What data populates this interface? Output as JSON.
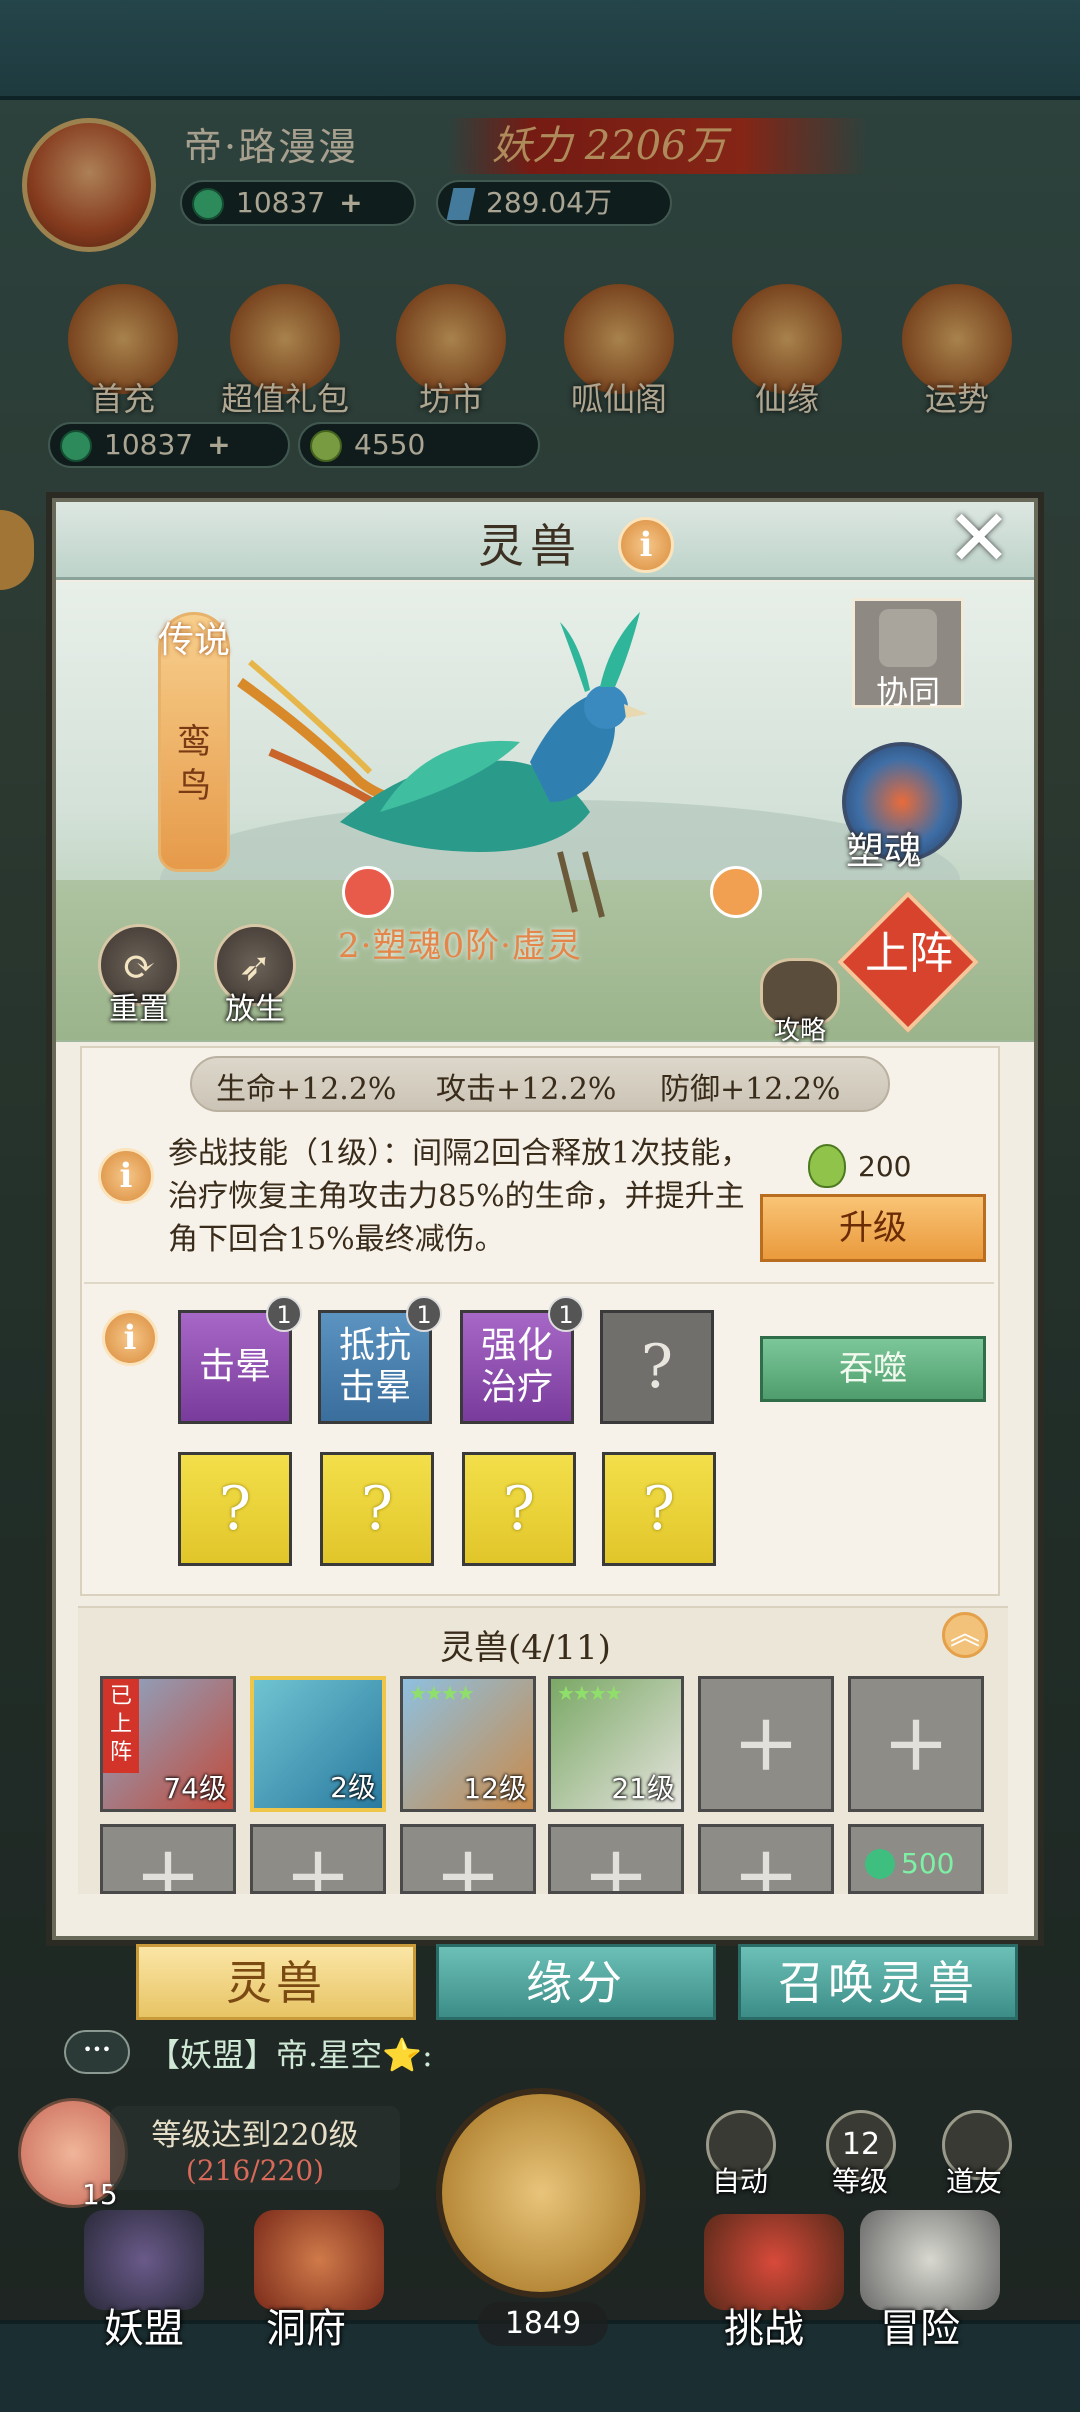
{
  "player": {
    "name": "帝·路漫漫",
    "power": "妖力 2206万",
    "gems": "10837",
    "crystal": "289.04万"
  },
  "menu": [
    {
      "label": "首充"
    },
    {
      "label": "超值礼包"
    },
    {
      "label": "坊市"
    },
    {
      "label": "呱仙阁"
    },
    {
      "label": "仙缘"
    },
    {
      "label": "运势"
    }
  ],
  "currency2": {
    "gems": "10837",
    "fruit": "4550"
  },
  "modal": {
    "title": "灵兽",
    "info_icon": "i",
    "close": "✕",
    "rarity": "传说",
    "pet_name": "鸾鸟",
    "stage": "2·塑魂0阶·虚灵",
    "reset": "重置",
    "release": "放生",
    "synergy": "协同",
    "soul": "塑魂",
    "deploy": "上阵",
    "guide": "攻略"
  },
  "stats": {
    "hp": "生命+12.2%",
    "atk": "攻击+12.2%",
    "def": "防御+12.2%"
  },
  "skill": {
    "text": "参战技能（1级）：间隔2回合释放1次技能，治疗恢复主角攻击力85%的生命，并提升主角下回合15%最终减伤。",
    "cost": "200",
    "upgrade": "升级",
    "devour": "吞噬"
  },
  "passives": [
    {
      "label": "击晕",
      "level": "1"
    },
    {
      "label": "抵抗击晕",
      "level": "1"
    },
    {
      "label": "强化治疗",
      "level": "1"
    },
    {
      "label": "?"
    },
    {
      "label": "?"
    },
    {
      "label": "?"
    },
    {
      "label": "?"
    },
    {
      "label": "?"
    }
  ],
  "roster": {
    "title": "灵兽(4/11)",
    "deployed_tag": "已上阵",
    "pets": [
      {
        "level": "74级"
      },
      {
        "level": "2级"
      },
      {
        "level": "12级"
      },
      {
        "level": "21级"
      }
    ],
    "unlock_cost": "500",
    "plus": "+"
  },
  "tabs": {
    "pets": "灵兽",
    "fate": "缘分",
    "summon": "召唤灵兽"
  },
  "chat": {
    "text": "【妖盟】帝.星空⭐:"
  },
  "quest": {
    "title": "等级达到220级",
    "progress": "(216/220)",
    "count": "15"
  },
  "hud": {
    "auto": "自动",
    "level_num": "12",
    "level": "等级",
    "friend": "道友",
    "axe_count": "1849"
  },
  "bottom_nav": {
    "guild": "妖盟",
    "cave": "洞府",
    "challenge": "挑战",
    "adventure": "冒险"
  },
  "colors": {
    "accent": "#ea9a3c",
    "green_btn": "#4f9d6d",
    "rarity": "#e69a4a"
  }
}
